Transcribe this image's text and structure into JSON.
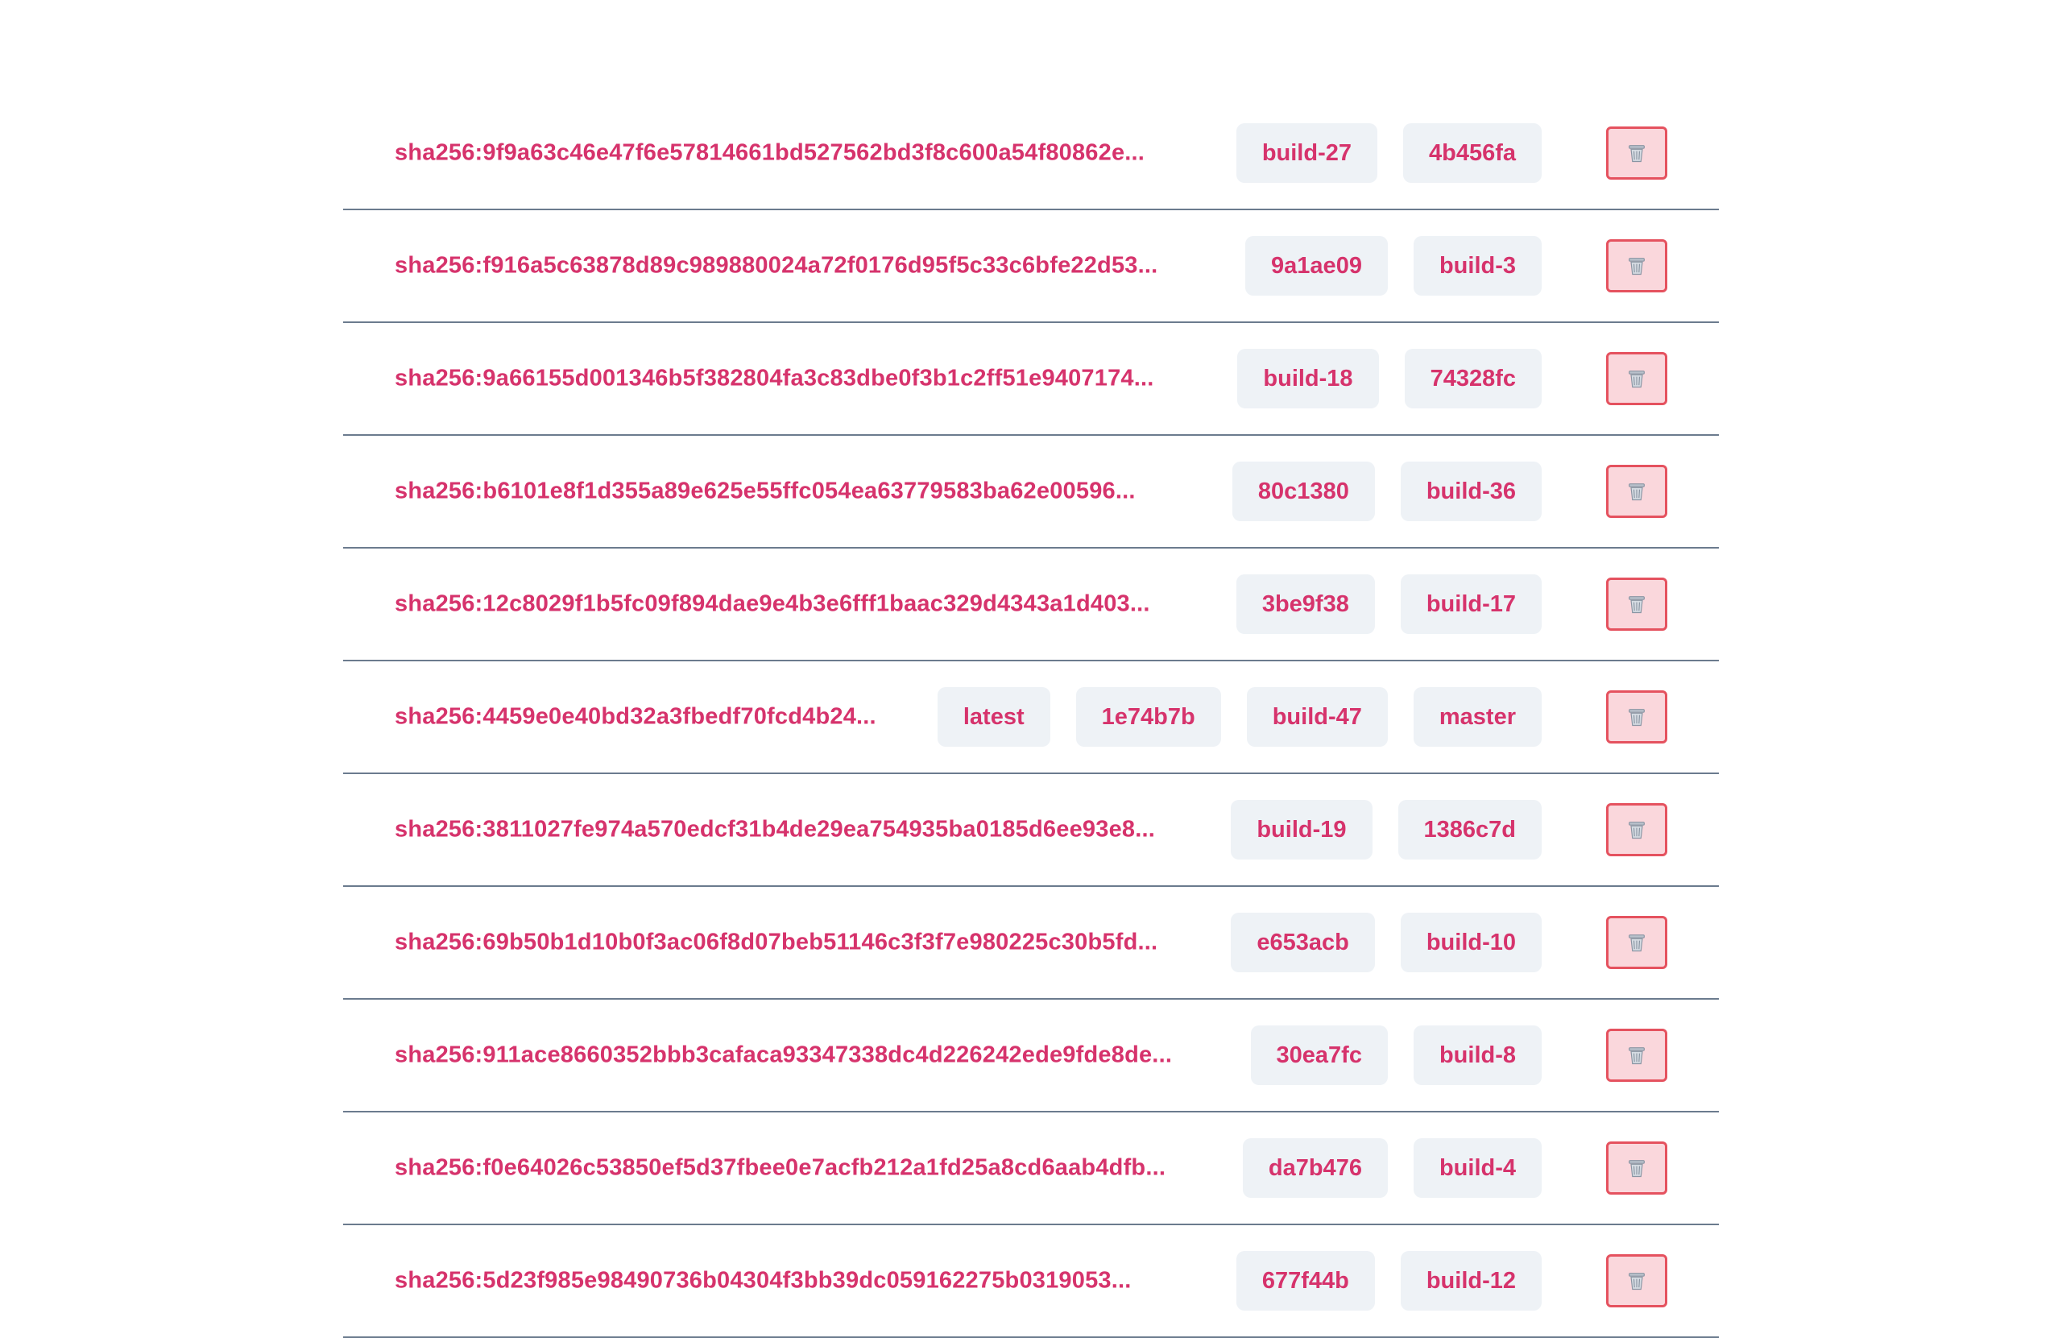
{
  "images": [
    {
      "digest": "sha256:9f9a63c46e47f6e57814661bd527562bd3f8c600a54f80862e...",
      "tags": [
        "build-27",
        "4b456fa"
      ]
    },
    {
      "digest": "sha256:f916a5c63878d89c989880024a72f0176d95f5c33c6bfe22d53...",
      "tags": [
        "9a1ae09",
        "build-3"
      ]
    },
    {
      "digest": "sha256:9a66155d001346b5f382804fa3c83dbe0f3b1c2ff51e9407174...",
      "tags": [
        "build-18",
        "74328fc"
      ]
    },
    {
      "digest": "sha256:b6101e8f1d355a89e625e55ffc054ea63779583ba62e00596...",
      "tags": [
        "80c1380",
        "build-36"
      ]
    },
    {
      "digest": "sha256:12c8029f1b5fc09f894dae9e4b3e6fff1baac329d4343a1d403...",
      "tags": [
        "3be9f38",
        "build-17"
      ]
    },
    {
      "digest": "sha256:4459e0e40bd32a3fbedf70fcd4b24...",
      "tags": [
        "latest",
        "1e74b7b",
        "build-47",
        "master"
      ]
    },
    {
      "digest": "sha256:3811027fe974a570edcf31b4de29ea754935ba0185d6ee93e8...",
      "tags": [
        "build-19",
        "1386c7d"
      ]
    },
    {
      "digest": "sha256:69b50b1d10b0f3ac06f8d07beb51146c3f3f7e980225c30b5fd...",
      "tags": [
        "e653acb",
        "build-10"
      ]
    },
    {
      "digest": "sha256:911ace8660352bbb3cafaca93347338dc4d226242ede9fde8de...",
      "tags": [
        "30ea7fc",
        "build-8"
      ]
    },
    {
      "digest": "sha256:f0e64026c53850ef5d37fbee0e7acfb212a1fd25a8cd6aab4dfb...",
      "tags": [
        "da7b476",
        "build-4"
      ]
    },
    {
      "digest": "sha256:5d23f985e98490736b04304f3bb39dc059162275b0319053...",
      "tags": [
        "677f44b",
        "build-12"
      ]
    }
  ],
  "icons": {
    "delete": "trash-icon"
  },
  "colors": {
    "accent_text": "#d6336c",
    "tag_background": "#eef2f6",
    "delete_border": "#e5525f",
    "delete_background": "#fad7dc",
    "row_divider": "#6b7b8e"
  }
}
